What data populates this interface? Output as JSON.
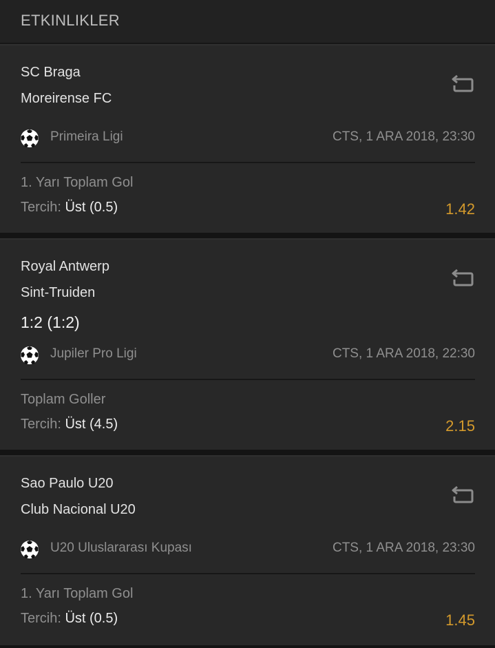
{
  "header": {
    "title": "ETKINLIKLER"
  },
  "events": [
    {
      "home": "SC Braga",
      "away": "Moreirense FC",
      "score": "",
      "league": "Primeira Ligi",
      "datetime": "CTS, 1 ARA 2018, 23:30",
      "market": "1. Yarı Toplam Gol",
      "pick_label": "Tercih:",
      "pick_value": "Üst (0.5)",
      "odds": "1.42"
    },
    {
      "home": "Royal Antwerp",
      "away": "Sint-Truiden",
      "score": "1:2 (1:2)",
      "league": "Jupiler Pro Ligi",
      "datetime": "CTS, 1 ARA 2018, 22:30",
      "market": "Toplam Goller",
      "pick_label": "Tercih:",
      "pick_value": "Üst (4.5)",
      "odds": "2.15"
    },
    {
      "home": "Sao Paulo U20",
      "away": "Club Nacional U20",
      "score": "",
      "league": "U20 Uluslararası Kupası",
      "datetime": "CTS, 1 ARA 2018, 23:30",
      "market": "1. Yarı Toplam Gol",
      "pick_label": "Tercih:",
      "pick_value": "Üst (0.5)",
      "odds": "1.45"
    }
  ],
  "icons": {
    "repeat": "repeat-icon",
    "sport": "soccer-ball-icon"
  },
  "colors": {
    "background": "#282828",
    "odds": "#d49a2c",
    "muted_text": "#8f8f8f",
    "primary_text": "#e2e2e2"
  }
}
